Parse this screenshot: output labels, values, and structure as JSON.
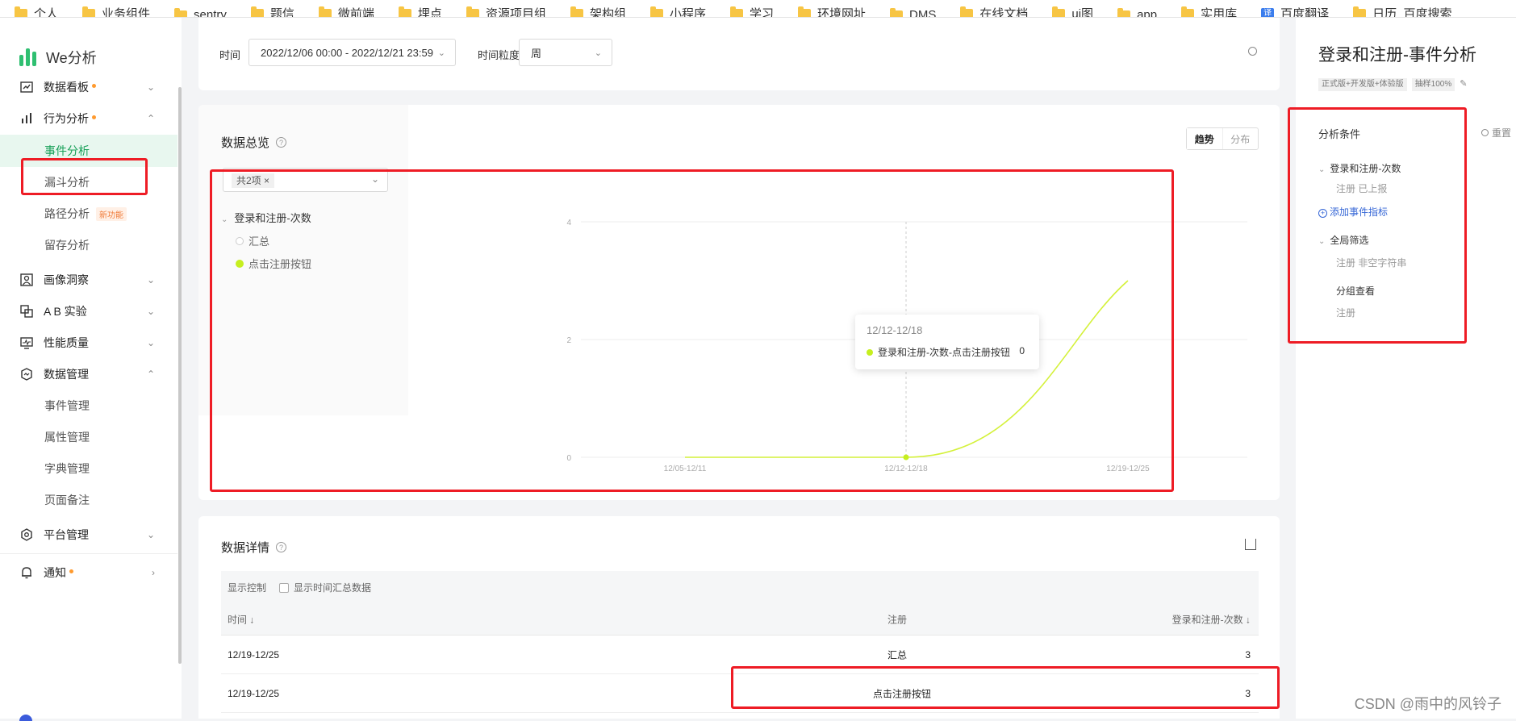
{
  "bookmarks": [
    "个人",
    "业务组件",
    "sentry",
    "题信",
    "微前端",
    "埋点",
    "资源项目组",
    "架构组",
    "小程序",
    "学习",
    "环境网址",
    "DMS",
    "在线文档",
    "ui图",
    "app",
    "实用库",
    "百度翻译",
    "日历_百度搜索"
  ],
  "sidebar": {
    "logo_text": "We分析",
    "groups": [
      {
        "label": "数据看板",
        "dot": true,
        "expanded": false
      },
      {
        "label": "行为分析",
        "dot": true,
        "expanded": true
      },
      {
        "label": "画像洞察",
        "dot": false,
        "expanded": false
      },
      {
        "label": "A B 实验",
        "dot": false,
        "expanded": false
      },
      {
        "label": "性能质量",
        "dot": false,
        "expanded": false
      },
      {
        "label": "数据管理",
        "dot": false,
        "expanded": true
      },
      {
        "label": "平台管理",
        "dot": false,
        "expanded": false
      },
      {
        "label": "通知",
        "dot": true,
        "expanded": false
      }
    ],
    "behavior_items": [
      "事件分析",
      "漏斗分析",
      "路径分析",
      "留存分析"
    ],
    "path_badge": "新功能",
    "data_items": [
      "事件管理",
      "属性管理",
      "字典管理",
      "页面备注"
    ]
  },
  "filters": {
    "time_label": "时间",
    "time_value": "2022/12/06 00:00 - 2022/12/21 23:59",
    "granularity_label": "时间粒度",
    "granularity_value": "周"
  },
  "overview": {
    "title": "数据总览",
    "help": "?",
    "selected_tag": "共2项",
    "legend_group": "登录和注册-次数",
    "legend_items": [
      {
        "label": "汇总",
        "color": "#ffffff",
        "hollow": true
      },
      {
        "label": "点击注册按钮",
        "color": "#c6ef1f",
        "hollow": false
      }
    ],
    "view_modes": [
      "趋势",
      "分布"
    ],
    "active_mode": "趋势",
    "tooltip": {
      "title": "12/12-12/18",
      "series": "登录和注册-次数-点击注册按钮",
      "value": "0"
    }
  },
  "chart_data": {
    "type": "line",
    "x": [
      "12/05-12/11",
      "12/12-12/18",
      "12/19-12/25"
    ],
    "series": [
      {
        "name": "登录和注册-次数-点击注册按钮",
        "values": [
          0,
          0,
          3
        ],
        "color": "#d4f13a"
      }
    ],
    "yticks": [
      0,
      2,
      4
    ],
    "ylim": [
      0,
      4
    ],
    "grid": true,
    "hover_index": 1
  },
  "details": {
    "title": "数据详情",
    "help": "?",
    "display_control": "显示控制",
    "show_time_summary": "显示时间汇总数据",
    "columns": [
      "时间",
      "注册",
      "登录和注册-次数"
    ],
    "rows": [
      {
        "time": "12/19-12/25",
        "register": "汇总",
        "count": "3"
      },
      {
        "time": "12/19-12/25",
        "register": "点击注册按钮",
        "count": "3"
      }
    ]
  },
  "right_panel": {
    "title": "登录和注册-事件分析",
    "chips": [
      "正式版+开发版+体验版",
      "抽样100%"
    ],
    "conditions_label": "分析条件",
    "reset_label": "重置",
    "metric_label": "登录和注册-次数",
    "metric_filter": "注册 已上报",
    "add_metric": "添加事件指标",
    "global_filter_label": "全局筛选",
    "global_filter_value": "注册 非空字符串",
    "group_label": "分组查看",
    "group_value": "注册"
  },
  "watermark": "CSDN @雨中的风铃子",
  "colors": {
    "accent_green": "#18a058",
    "highlight_red": "#ee1c25",
    "line_lime": "#d4f13a"
  }
}
